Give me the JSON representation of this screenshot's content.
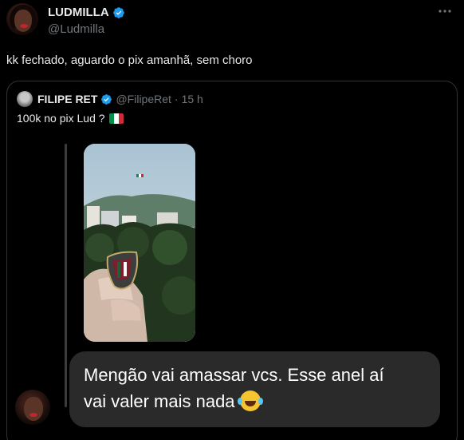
{
  "author": {
    "display_name": "LUDMILLA",
    "handle": "@Ludmilla",
    "verified": true
  },
  "tweet": {
    "text": "kk fechado, aguardo o pix amanhã, sem choro"
  },
  "quoted": {
    "display_name": "FILIPE RET",
    "handle": "@FilipeRet",
    "separator": "·",
    "time": "15 h",
    "text": "100k no pix Lud ?",
    "flag_icon": "italy-flag-icon"
  },
  "meme": {
    "line1": "Mengão vai amassar vcs. Esse anel aí",
    "line2": "vai valer mais nada",
    "emoji": "laughing-tears-emoji"
  },
  "colors": {
    "background": "#000000",
    "text": "#e7e9ea",
    "secondary": "#71767b",
    "verified": "#1d9bf0",
    "border": "#2f3336",
    "bubble": "#2a2a2a"
  }
}
